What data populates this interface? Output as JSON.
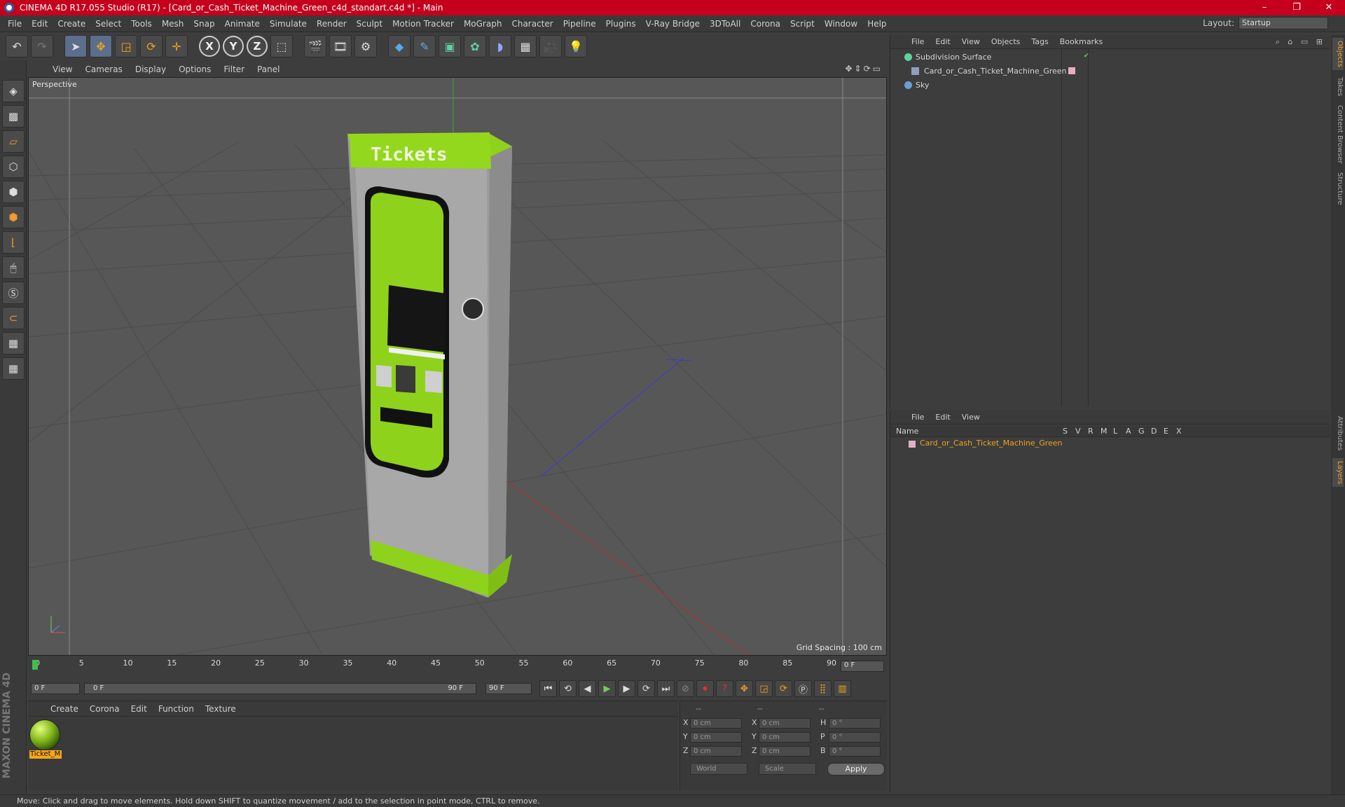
{
  "window": {
    "title": "CINEMA 4D R17.055 Studio (R17) - [Card_or_Cash_Ticket_Machine_Green_c4d_standart.c4d *] - Main",
    "controls": [
      "–",
      "❐",
      "✕"
    ]
  },
  "menubar": {
    "items": [
      "File",
      "Edit",
      "Create",
      "Select",
      "Tools",
      "Mesh",
      "Snap",
      "Animate",
      "Simulate",
      "Render",
      "Sculpt",
      "Motion Tracker",
      "MoGraph",
      "Character",
      "Pipeline",
      "Plugins",
      "V-Ray Bridge",
      "3DToAll",
      "Corona",
      "Script",
      "Window",
      "Help"
    ],
    "layout_label": "Layout:",
    "layout_value": "Startup"
  },
  "toolbar": {
    "icons": [
      "undo-icon",
      "redo-icon",
      "select-icon",
      "move-icon",
      "scale-icon",
      "rotate-icon",
      "live-select-icon",
      "x-axis-icon",
      "y-axis-icon",
      "z-axis-icon",
      "coordinate-system-icon",
      "render-view-icon",
      "render-picture-viewer-icon",
      "edit-render-settings-icon",
      "cube-icon",
      "pen-icon",
      "subdivision-icon",
      "array-icon",
      "deformer-icon",
      "floor-icon",
      "camera-icon",
      "light-icon"
    ],
    "axis_labels": [
      "X",
      "Y",
      "Z"
    ]
  },
  "left_tools": [
    "model-mode-icon",
    "texture-mode-icon",
    "workplane-icon",
    "points-mode-icon",
    "edges-mode-icon",
    "polygons-mode-icon",
    "axis-mode-icon",
    "tweak-mode-icon",
    "solo-icon",
    "magnet-icon",
    "snap-icon",
    "animation-snap-icon"
  ],
  "maxon_logo": "MAXON CINEMA 4D",
  "viewport": {
    "menu": [
      "View",
      "Cameras",
      "Display",
      "Options",
      "Filter",
      "Panel"
    ],
    "label": "Perspective",
    "grid_spacing": "Grid Spacing : 100 cm",
    "model_text": "Tickets"
  },
  "timeline": {
    "ticks": [
      "0",
      "5",
      "10",
      "15",
      "20",
      "25",
      "30",
      "35",
      "40",
      "45",
      "50",
      "55",
      "60",
      "65",
      "70",
      "75",
      "80",
      "85",
      "90"
    ],
    "current_frame": "0 F",
    "start_field": "0 F",
    "range_start": "0 F",
    "range_end": "90 F",
    "end_field": "90 F"
  },
  "material_manager": {
    "menu": [
      "Create",
      "Corona",
      "Edit",
      "Function",
      "Texture"
    ],
    "materials": [
      {
        "name": "Ticket_M"
      }
    ]
  },
  "coordinates": {
    "headers": [
      "--",
      "--",
      "--"
    ],
    "rows": [
      {
        "a": "X",
        "av": "0 cm",
        "b": "X",
        "bv": "0 cm",
        "c": "H",
        "cv": "0 °"
      },
      {
        "a": "Y",
        "av": "0 cm",
        "b": "Y",
        "bv": "0 cm",
        "c": "P",
        "cv": "0 °"
      },
      {
        "a": "Z",
        "av": "0 cm",
        "b": "Z",
        "bv": "0 cm",
        "c": "B",
        "cv": "0 °"
      }
    ],
    "mode": "World",
    "type": "Scale",
    "apply": "Apply"
  },
  "object_manager": {
    "menu": [
      "File",
      "Edit",
      "View",
      "Objects",
      "Tags",
      "Bookmarks"
    ],
    "objects": [
      {
        "name": "Subdivision Surface",
        "indent": 0
      },
      {
        "name": "Card_or_Cash_Ticket_Machine_Green",
        "indent": 1
      },
      {
        "name": "Sky",
        "indent": 0
      }
    ]
  },
  "layer_manager": {
    "menu": [
      "File",
      "Edit",
      "View"
    ],
    "columns": [
      "Name",
      "S",
      "V",
      "R",
      "M",
      "L",
      "A",
      "G",
      "D",
      "E",
      "X"
    ],
    "layers": [
      {
        "name": "Card_or_Cash_Ticket_Machine_Green"
      }
    ]
  },
  "side_tabs": [
    "Objects",
    "Takes",
    "Content Browser",
    "Structure",
    "Attributes",
    "Layers"
  ],
  "status": "Move: Click and drag to move elements. Hold down SHIFT to quantize movement / add to the selection in point mode, CTRL to remove.",
  "colors": {
    "accent": "#c4001c",
    "model_green": "#8fd21b",
    "layer_name": "#f2a21c"
  }
}
